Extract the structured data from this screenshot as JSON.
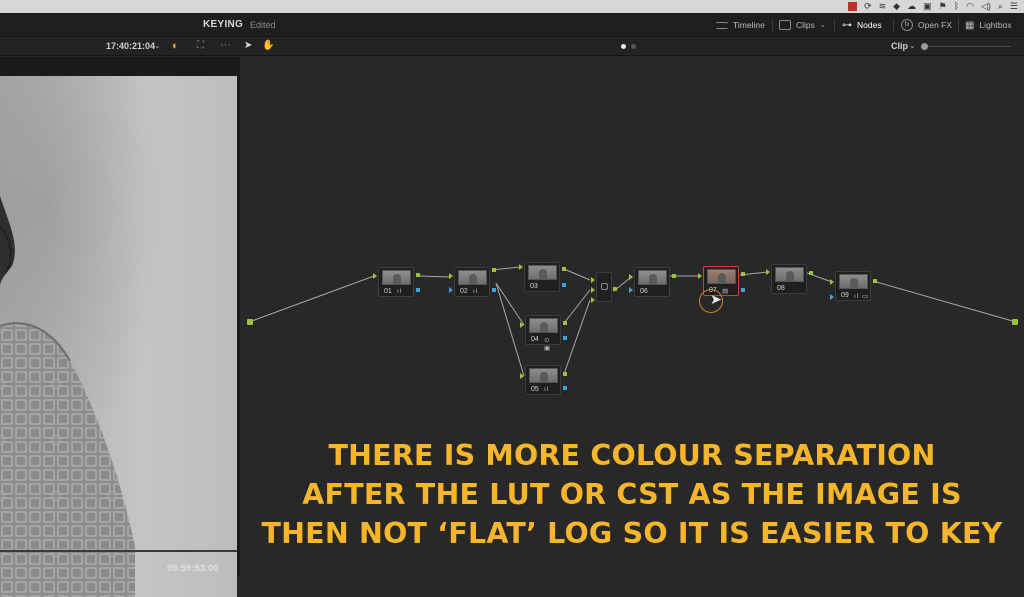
{
  "project": {
    "title": "KEYING",
    "status": "Edited"
  },
  "toolbar": {
    "timeline_label": "Timeline",
    "clips_label": "Clips",
    "nodes_label": "Nodes",
    "openfx_label": "Open FX",
    "lightbox_label": "Lightbox"
  },
  "viewer": {
    "timecode_top": "17:40:21:04",
    "timecode_bottom": "09:59:53:00"
  },
  "node_panel": {
    "mode": "Clip",
    "nodes": [
      {
        "label": "01",
        "icons": "ıl"
      },
      {
        "label": "02",
        "icons": "ıl"
      },
      {
        "label": "03",
        "icons": ""
      },
      {
        "label": "04",
        "icons": "⊙ ▣"
      },
      {
        "label": "05",
        "icons": "ıl"
      },
      {
        "label": "06",
        "icons": ""
      },
      {
        "label": "07",
        "icons": "▤"
      },
      {
        "label": "08",
        "icons": ""
      },
      {
        "label": "09",
        "icons": "ıl ▭"
      }
    ]
  },
  "caption": {
    "line1": "THERE IS MORE COLOUR SEPARATION",
    "line2": "AFTER THE LUT OR CST AS THE IMAGE IS",
    "line3": "THEN NOT ‘FLAT’ LOG SO IT IS EASIER TO KEY"
  },
  "colors": {
    "caption": "#f5b62b",
    "port_rgb": "#9cc436",
    "port_key": "#3aa4dc",
    "selected_node": "#c8452e"
  }
}
